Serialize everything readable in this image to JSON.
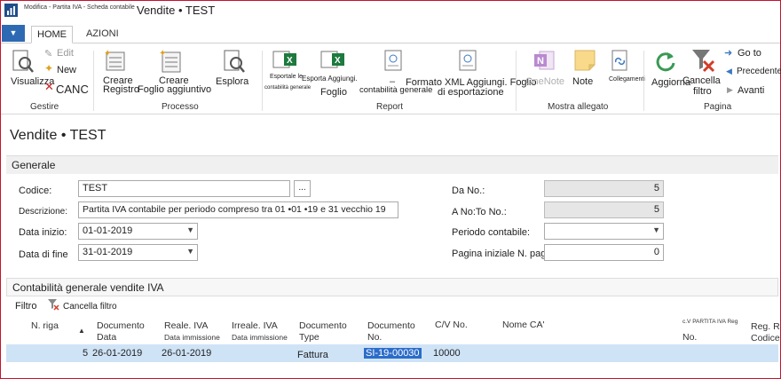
{
  "window": {
    "small_title": "Modifica - Partita IVA - Scheda contabile -",
    "main_title": "Vendite • TEST"
  },
  "tabs": [
    {
      "label": "HOME"
    },
    {
      "label": "AZIONI"
    }
  ],
  "ribbon": {
    "gestire": {
      "visualizza": "Visualizza",
      "edit": "Edit",
      "new": "New",
      "canc": "CANC",
      "group": "Gestire"
    },
    "processo": {
      "creare1": "Creare",
      "registro": "Registro",
      "creare2": "Creare",
      "foglio_aggiuntivo": "Foglio aggiuntivo",
      "esplora": "Esplora",
      "group": "Processo"
    },
    "report": {
      "esporta_contabilita_line1": "Esportale le",
      "esporta_contabilita_line2": "contabilità generale",
      "esporta_aggiungi_line1": "Esporta Aggiungi.",
      "esporta_aggiungi_line2": "Foglio",
      "contabilita_generale": "contabilità generale",
      "formato_xml_line1": "Formato XML Aggiungi. Foglio",
      "formato_xml_line2": "di esportazione",
      "group": "Report",
      "dash": "–"
    },
    "allegato": {
      "onenote": "OneNote",
      "note": "Note",
      "collegamenti": "Collegamenti",
      "group": "Mostra allegato"
    },
    "pagina": {
      "aggiorna": "Aggiorna",
      "cancella_line1": "Cancella",
      "cancella_line2": "filtro",
      "goto": "Go to",
      "precedente": "Precedente",
      "avanti": "Avanti",
      "group": "Pagina"
    }
  },
  "page_title": "Vendite • TEST",
  "generale": {
    "header": "Generale",
    "codice_label": "Codice:",
    "codice_value": "TEST",
    "ellipsis": "...",
    "descrizione_label": "Descrizione:",
    "descrizione_value": "Partita IVA contabile per periodo compreso tra 01 •01 •19 e 31 vecchio 19",
    "data_inizio_label": "Data inizio:",
    "data_inizio_value": "01-01-2019",
    "data_fine_label": "Data di fine",
    "data_fine_value": "31-01-2019",
    "da_no_label": "Da No.:",
    "da_no_value": "5",
    "a_no_label": "A No:To No.:",
    "a_no_value": "5",
    "periodo_label": "Periodo contabile:",
    "periodo_value": "",
    "pagina_label": "Pagina iniziale N. pagina:",
    "pagina_value": "0"
  },
  "subpage": {
    "header": "Contabilità generale vendite IVA",
    "filtro": "Filtro",
    "cancella_filtro": "Cancella filtro",
    "columns": {
      "n_riga": "N. riga",
      "documento_data_1": "Documento",
      "documento_data_2": "Data",
      "reale_iva_1": "Reale. IVA",
      "reale_iva_2": "Data immissione",
      "irreale_iva_1": "Irreale. IVA",
      "irreale_iva_2": "Data immissione",
      "doc_type_1": "Documento",
      "doc_type_2": "Type",
      "doc_no_1": "Documento",
      "doc_no_2": "No.",
      "cv_no": "C/V No.",
      "nome_ca": "Nome CA'",
      "cv_partita_1": "c.V PARTITA IVA Reg",
      "cv_partita_2": "No.",
      "reg_r_1": "Reg. R",
      "reg_r_2": "Codice"
    },
    "rows": [
      {
        "n_riga": "5",
        "documento_data": "26-01-2019",
        "reale_iva_data": "26-01-2019",
        "irreale_iva_data": "",
        "doc_type": "Fattura",
        "doc_no": "SI-19-00030",
        "cv_no": "10000"
      }
    ]
  },
  "colors": {
    "accent_blue": "#2d6ab3",
    "selected_row": "#cfe3f6",
    "selected_cell": "#2c6cc9",
    "window_border": "#c8102e"
  }
}
